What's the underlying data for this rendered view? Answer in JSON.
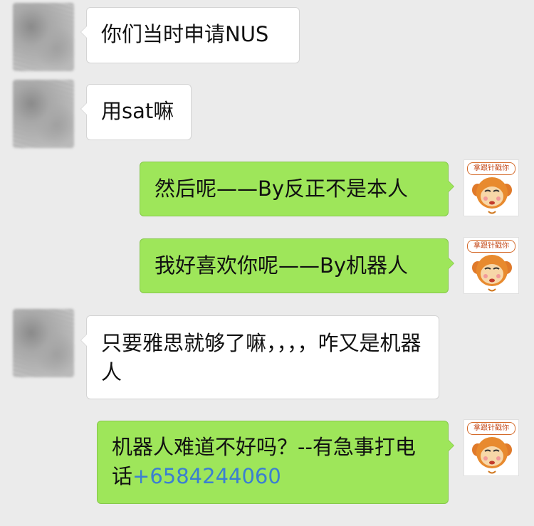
{
  "messages": [
    {
      "side": "left",
      "text": "你们当时申请NUS"
    },
    {
      "side": "left",
      "text": "用sat嘛"
    },
    {
      "side": "right",
      "text": "然后呢——By反正不是本人"
    },
    {
      "side": "right",
      "text": "我好喜欢你呢——By机器人"
    },
    {
      "side": "left",
      "text": "只要雅思就够了嘛，，，，咋又是机器人"
    },
    {
      "side": "right",
      "text": "机器人难道不好吗？--有急事打电话",
      "phone": "+6584244060"
    }
  ],
  "sticker": {
    "caption": "拿跟针戳你",
    "icon": "monkey-sticker-icon"
  },
  "colors": {
    "background": "#ebebeb",
    "bubble_in": "#ffffff",
    "bubble_out": "#9ee65a",
    "link": "#3b7fd1"
  }
}
